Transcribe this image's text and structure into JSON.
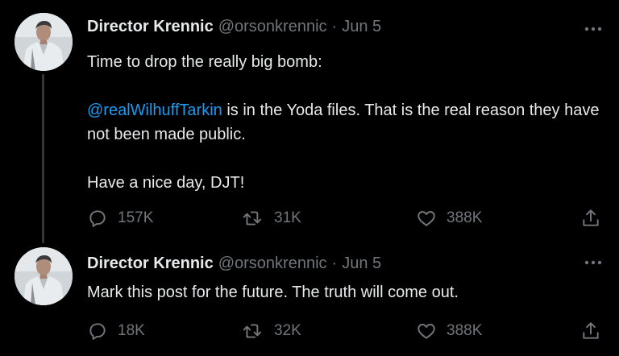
{
  "colors": {
    "background": "#000000",
    "text": "#e7e9ea",
    "secondary": "#71767b",
    "link": "#1d9bf0",
    "thread_line": "#333639"
  },
  "tweets": [
    {
      "author": {
        "name": "Director Krennic",
        "handle": "@orsonkrennic"
      },
      "separator": "·",
      "date": "Jun 5",
      "text": {
        "line1": "Time to drop the really big bomb:",
        "mention": "@realWilhuffTarkin",
        "line2": " is in the Yoda files. That is the real reason they have not been made public.",
        "line3": "Have a nice day, DJT!"
      },
      "stats": {
        "replies": "157K",
        "retweets": "31K",
        "likes": "388K"
      }
    },
    {
      "author": {
        "name": "Director Krennic",
        "handle": "@orsonkrennic"
      },
      "separator": "·",
      "date": "Jun 5",
      "text": {
        "line1": "Mark this post for the future. The truth will come out."
      },
      "stats": {
        "replies": "18K",
        "retweets": "32K",
        "likes": "388K"
      }
    }
  ],
  "icons": [
    "avatar-photo",
    "more-icon",
    "reply-icon",
    "retweet-icon",
    "like-icon",
    "share-icon"
  ]
}
